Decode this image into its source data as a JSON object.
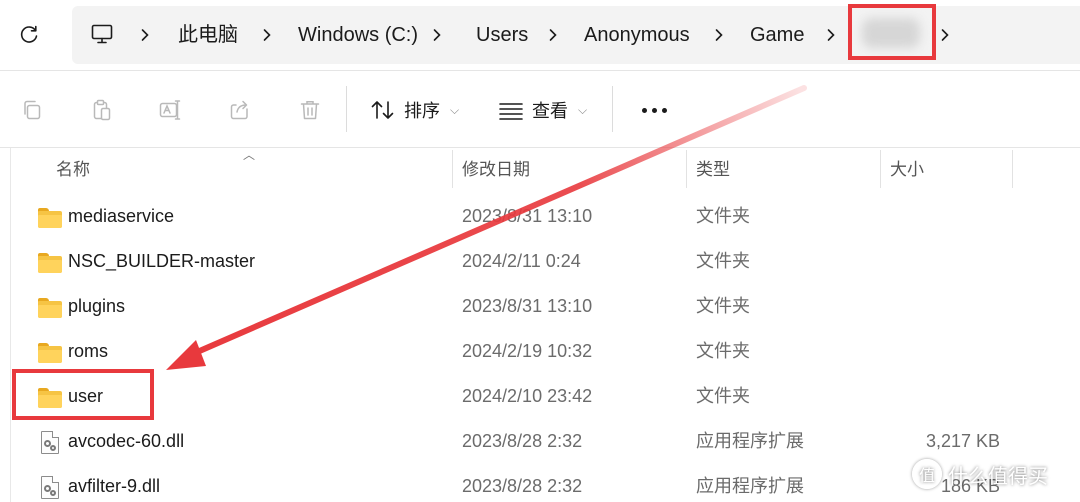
{
  "address_bar": {
    "crumbs": [
      "此电脑",
      "Windows (C:)",
      "Users",
      "Anonymous",
      "Game"
    ],
    "separator": "›"
  },
  "toolbar": {
    "sort_label": "排序",
    "view_label": "查看",
    "icons": [
      "copy-icon",
      "paste-icon",
      "rename-icon",
      "share-icon",
      "delete-icon",
      "sort-icon",
      "view-icon",
      "more-icon"
    ]
  },
  "columns": {
    "name": "名称",
    "modified": "修改日期",
    "type": "类型",
    "size": "大小"
  },
  "files": [
    {
      "name": "mediaservice",
      "modified": "2023/8/31 13:10",
      "type": "文件夹",
      "size": "",
      "icon": "folder-icon"
    },
    {
      "name": "NSC_BUILDER-master",
      "modified": "2024/2/11 0:24",
      "type": "文件夹",
      "size": "",
      "icon": "folder-icon"
    },
    {
      "name": "plugins",
      "modified": "2023/8/31 13:10",
      "type": "文件夹",
      "size": "",
      "icon": "folder-icon"
    },
    {
      "name": "roms",
      "modified": "2024/2/19 10:32",
      "type": "文件夹",
      "size": "",
      "icon": "folder-icon"
    },
    {
      "name": "user",
      "modified": "2024/2/10 23:42",
      "type": "文件夹",
      "size": "",
      "icon": "folder-icon"
    },
    {
      "name": "avcodec-60.dll",
      "modified": "2023/8/28 2:32",
      "type": "应用程序扩展",
      "size": "3,217 KB",
      "icon": "dll-file-icon"
    },
    {
      "name": "avfilter-9.dll",
      "modified": "2023/8/28 2:32",
      "type": "应用程序扩展",
      "size": "186 KB",
      "icon": "dll-file-icon"
    }
  ],
  "annotation": {
    "color": "#e8393d"
  },
  "watermark": {
    "logo_glyph": "值",
    "text": "什么值得买"
  },
  "colors": {
    "folder": "#f6c444",
    "address_bg": "#f3f3f3",
    "secondary_text": "#6b6b6b"
  }
}
